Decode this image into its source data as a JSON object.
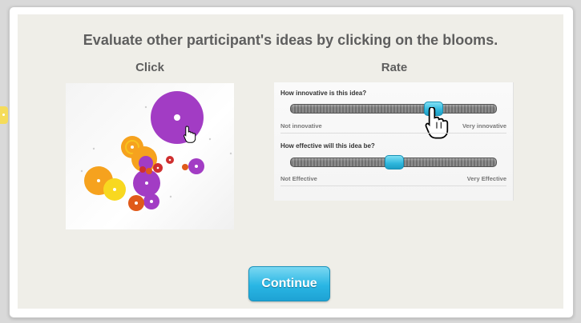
{
  "heading": "Evaluate other participant's ideas by clicking on the blooms.",
  "columns": {
    "click_title": "Click",
    "rate_title": "Rate"
  },
  "rating": {
    "q1": {
      "label": "How innovative is this idea?",
      "min_label": "Not innovative",
      "max_label": "Very innovative",
      "value_fraction": 0.7
    },
    "q2": {
      "label": "How effective will this idea be?",
      "min_label": "Not Effective",
      "max_label": "Very Effective",
      "value_fraction": 0.5
    }
  },
  "continue_button": "Continue",
  "colors": {
    "purple": "#a23cc4",
    "orange": "#f6a21e",
    "yellow": "#f8d820",
    "red": "#cf2f2f",
    "accent_blue": "#29b6e4"
  },
  "icons": {
    "cursor_hand": "hand-pointer-icon"
  }
}
